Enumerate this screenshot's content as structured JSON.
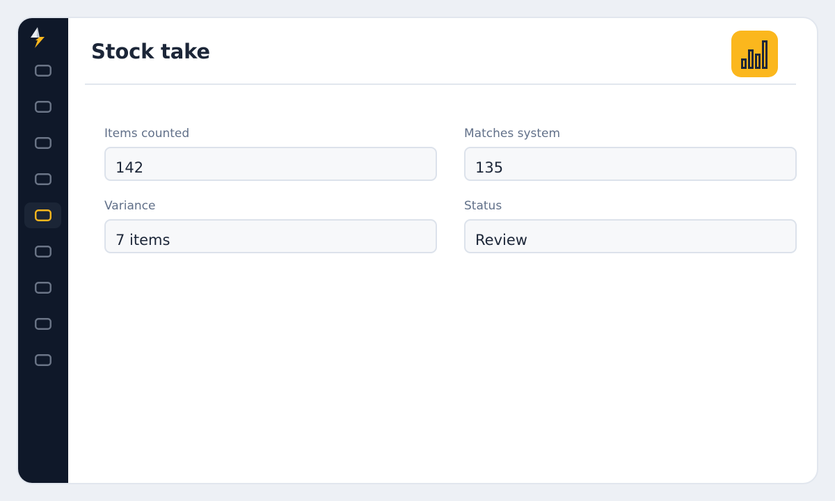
{
  "header": {
    "title": "Stock take",
    "report_icon": "bar-chart-icon"
  },
  "rail": {
    "logo_icon": "lightning-logo-icon",
    "items": [
      {
        "icon": "rounded-rect-icon",
        "active": false
      },
      {
        "icon": "rounded-rect-icon",
        "active": false
      },
      {
        "icon": "rounded-rect-icon",
        "active": false
      },
      {
        "icon": "rounded-rect-icon",
        "active": false
      },
      {
        "icon": "rounded-rect-icon",
        "active": true
      },
      {
        "icon": "rounded-rect-icon",
        "active": false
      },
      {
        "icon": "rounded-rect-icon",
        "active": false
      },
      {
        "icon": "rounded-rect-icon",
        "active": false
      },
      {
        "icon": "rounded-rect-icon",
        "active": false
      }
    ]
  },
  "fields": {
    "items_counted": {
      "label": "Items counted",
      "value": "142"
    },
    "matches_system": {
      "label": "Matches system",
      "value": "135"
    },
    "variance": {
      "label": "Variance",
      "value": "7 items"
    },
    "status": {
      "label": "Status",
      "value": "Review"
    }
  },
  "colors": {
    "accent": "#fbb71d",
    "sidebar": "#0f1829",
    "icon_inactive": "#6b7587",
    "title_text": "#1c2638",
    "label_text": "#617089"
  }
}
